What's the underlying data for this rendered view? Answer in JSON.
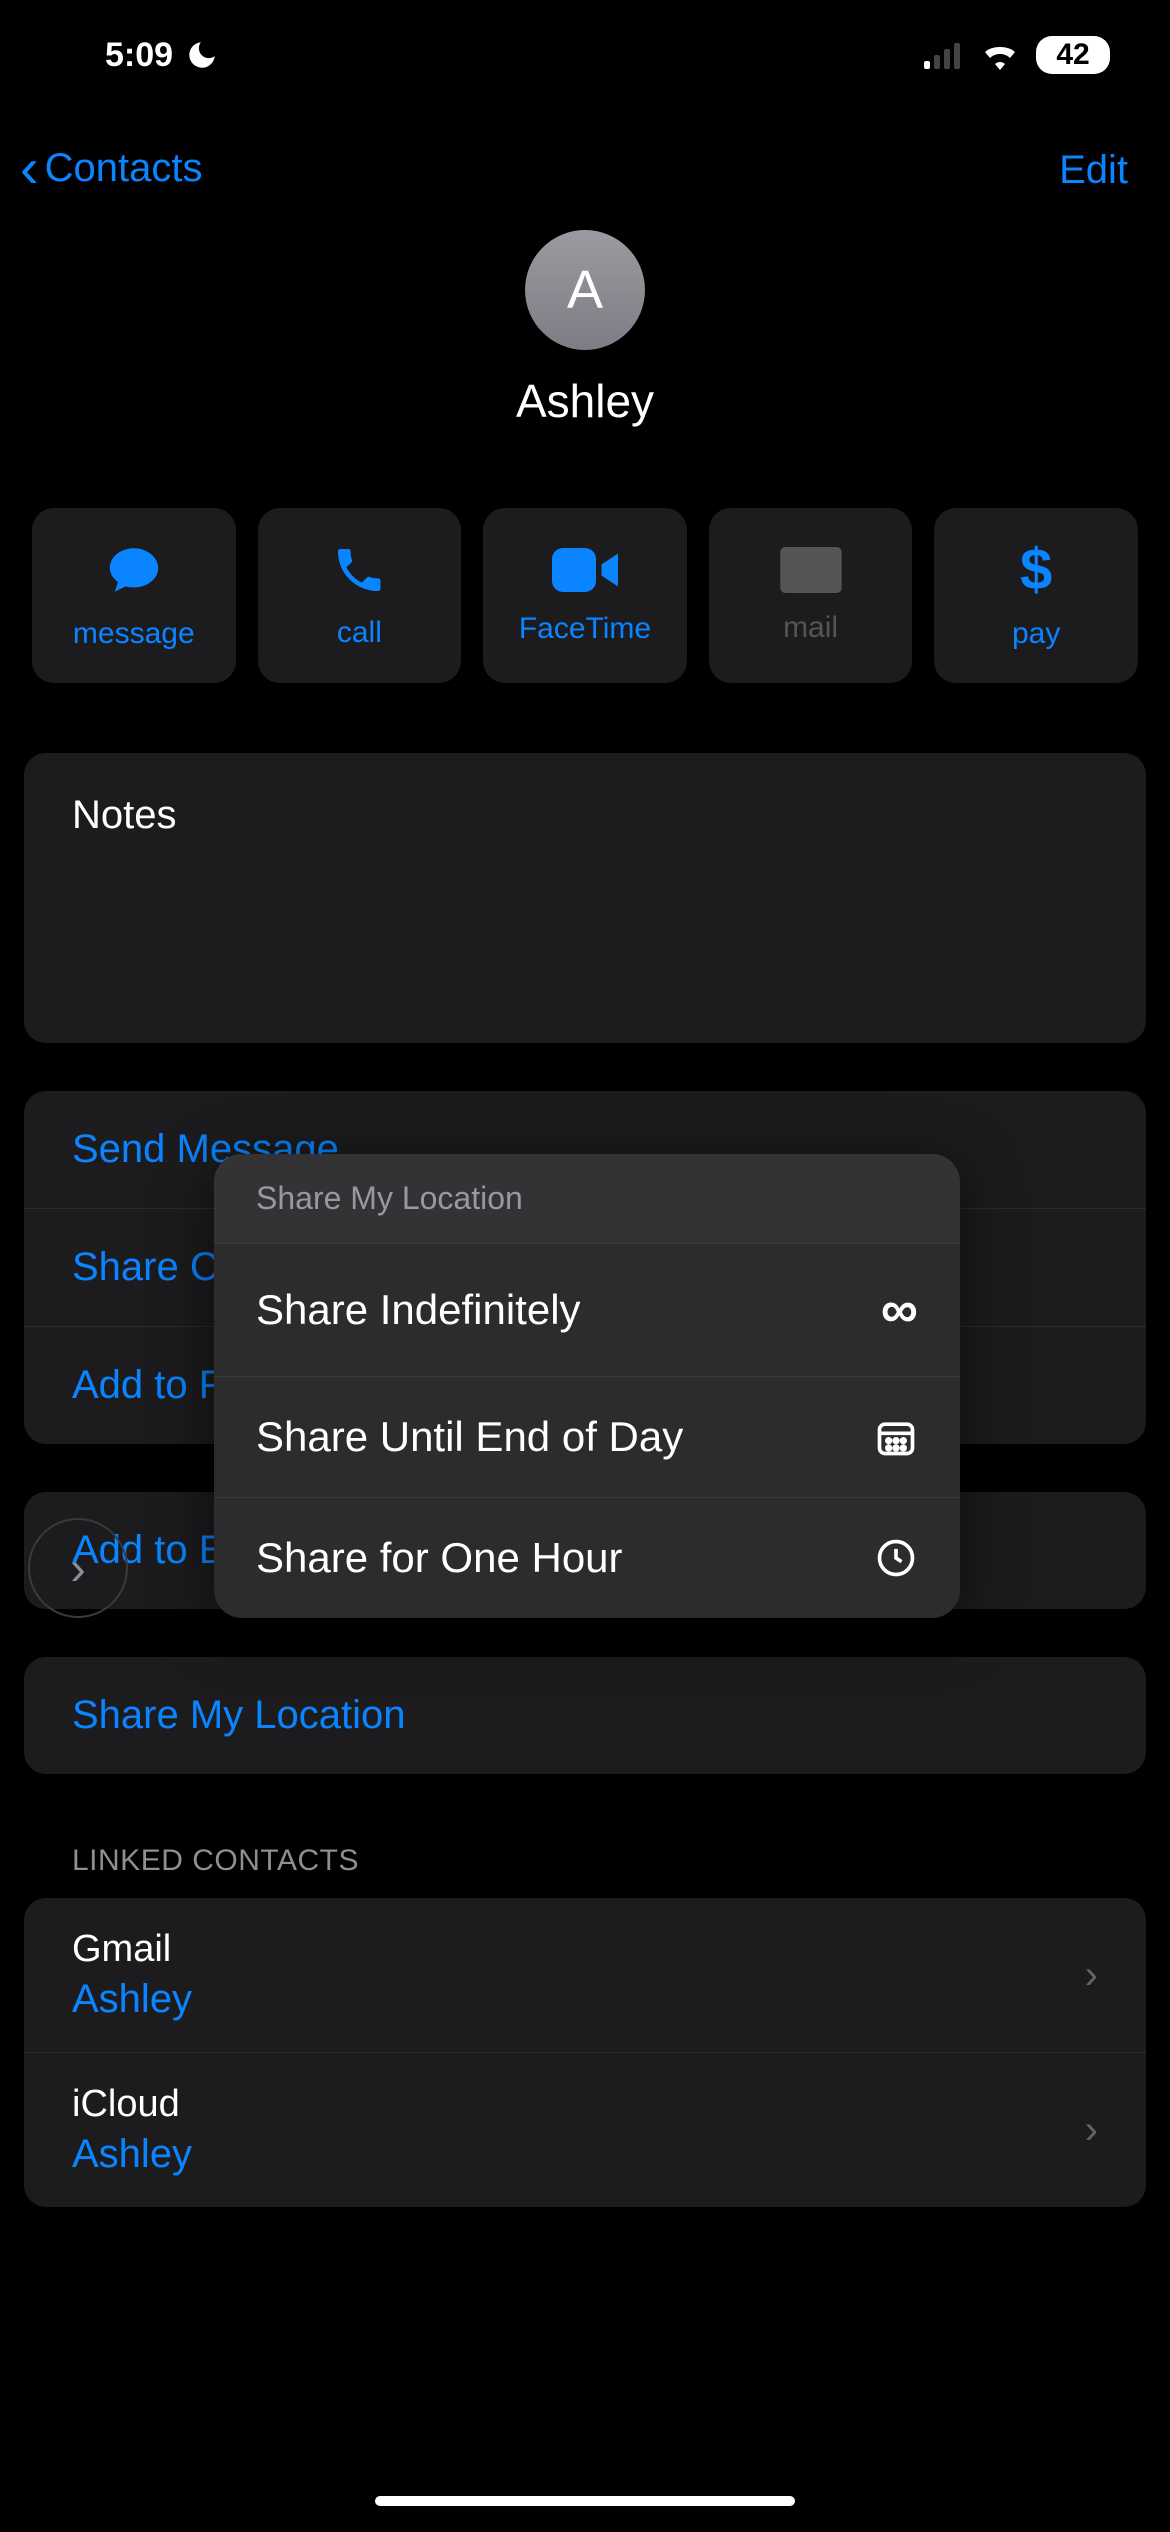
{
  "status": {
    "time": "5:09",
    "battery": "42"
  },
  "nav": {
    "back_label": "Contacts",
    "edit_label": "Edit"
  },
  "contact": {
    "initial": "A",
    "name": "Ashley"
  },
  "actions": {
    "message": "message",
    "call": "call",
    "facetime": "FaceTime",
    "mail": "mail",
    "pay": "pay"
  },
  "notes": {
    "title": "Notes"
  },
  "options": {
    "send_message": "Send Message",
    "share_contact": "Share Contact",
    "add_favorites": "Add to Favorites",
    "add_emergency": "Add to Emergency Contacts",
    "share_location": "Share My Location"
  },
  "linked": {
    "header": "LINKED CONTACTS",
    "items": [
      {
        "source": "Gmail",
        "name": "Ashley"
      },
      {
        "source": "iCloud",
        "name": "Ashley"
      }
    ]
  },
  "popover": {
    "title": "Share My Location",
    "options": [
      {
        "label": "Share Indefinitely",
        "icon": "infinity"
      },
      {
        "label": "Share Until End of Day",
        "icon": "calendar"
      },
      {
        "label": "Share for One Hour",
        "icon": "clock"
      }
    ]
  }
}
